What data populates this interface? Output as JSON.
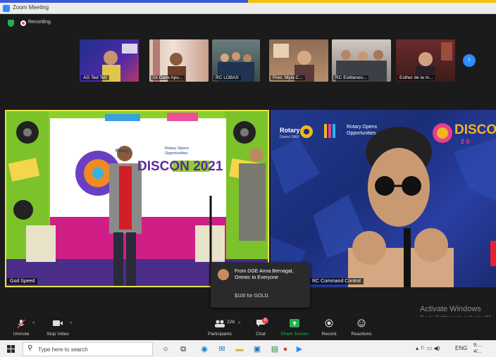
{
  "window": {
    "title": "Zoom Meeting"
  },
  "status": {
    "recording_label": "Recording"
  },
  "gallery": {
    "thumbnails": [
      {
        "name": "AG Ted Teh"
      },
      {
        "name": "GI Dave Apu..."
      },
      {
        "name": "RC LOBAS"
      },
      {
        "name": "Pres. Myla C..."
      },
      {
        "name": "RC Estillanes..."
      },
      {
        "name": "Esther de la m..."
      }
    ],
    "next_icon": "chevron-right-icon"
  },
  "main": {
    "left_tile": {
      "name": "God Speed",
      "backdrop_org": "Rotary",
      "backdrop_org2": "Rotary Opens Opportunities",
      "event": "DISCON 2021"
    },
    "right_tile": {
      "name": "RC Command Control",
      "brand": "Rotary",
      "district": "District 3860",
      "tagline": "Rotary Opens Opportunities",
      "event": "DISCON",
      "event_year": "2 0"
    }
  },
  "chat_popup": {
    "from_line": "From DGE Anna Bernagat, Omnec to Everyone",
    "message": "$100 for GOLD."
  },
  "watermark": {
    "line1": "Activate Windows",
    "line2": "Go to Settings to activate Wi..."
  },
  "toolbar": {
    "unmute": "Unmute",
    "stop_video": "Stop Video",
    "participants": "Participants",
    "participants_count": "228",
    "chat": "Chat",
    "chat_badge": "5",
    "share_screen": "Share Screen",
    "record": "Record",
    "reactions": "Reactions"
  },
  "taskbar": {
    "search_placeholder": "Type here to search",
    "language": "ENG",
    "time": "9:...",
    "date": "4/..."
  },
  "colors": {
    "accent": "#2d8cff",
    "share_green": "#23b14d",
    "record_red": "#e9484b"
  }
}
